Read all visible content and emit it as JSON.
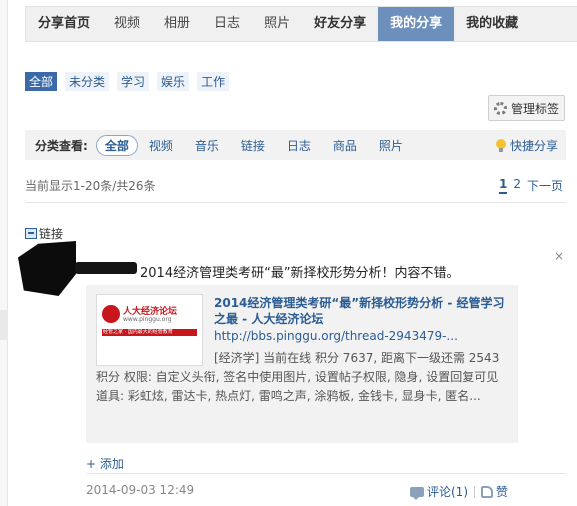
{
  "nav": {
    "tabs": [
      {
        "label": "分享首页"
      },
      {
        "label": "视频"
      },
      {
        "label": "相册"
      },
      {
        "label": "日志"
      },
      {
        "label": "照片"
      },
      {
        "label": "好友分享"
      },
      {
        "label": "我的分享"
      },
      {
        "label": "我的收藏"
      }
    ],
    "active_index": 6
  },
  "filters": {
    "items": [
      "全部",
      "未分类",
      "学习",
      "娱乐",
      "工作"
    ],
    "active_index": 0
  },
  "manage_tags": {
    "label": "管理标签",
    "icon": "gear-icon"
  },
  "category_bar": {
    "label": "分类查看:",
    "items": [
      "全部",
      "视频",
      "音乐",
      "链接",
      "日志",
      "商品",
      "照片"
    ],
    "active_index": 0,
    "quick_share": {
      "label": "快捷分享",
      "icon": "lightbulb-icon"
    }
  },
  "listing": {
    "count_text": "当前显示1-20条/共26条",
    "pager": {
      "page1": "1",
      "page2": "2",
      "next": "下一页"
    }
  },
  "share_item": {
    "type_label": "链接",
    "close": "×",
    "text": "2014经济管理类考研“最”新择校形势分析！内容不错。",
    "card": {
      "thumb": {
        "site_name": "人大经济论坛",
        "site_url": "www.pinggu.org",
        "slogan": "经管之家 · 国内最大的经管教育"
      },
      "title": "2014经济管理类考研“最”新择校形势分析 - 经管学习之最 - 人大经济论坛",
      "url": "http://bbs.pinggu.org/thread-2943479-...",
      "desc_line1": "[经济学] 当前在线 积分 7637, 距离下一级还需 2543 积分 权限: 自定义头衔, 签名中使用图片, 设置帖子权限, 隐身, 设置回复可见 道具: 彩虹炫, 雷达卡, 热点灯, 雷鸣之声, 涂鸦板, 金钱卡, 显身卡, 匿名..."
    },
    "add_label": "+ 添加",
    "timestamp": "2014-09-03 12:49",
    "comment_label": "评论(1)",
    "like_label": "赞"
  },
  "colors": {
    "accent": "#6d8fbc",
    "link": "#2b5c93",
    "brand_red": "#c8161d"
  }
}
